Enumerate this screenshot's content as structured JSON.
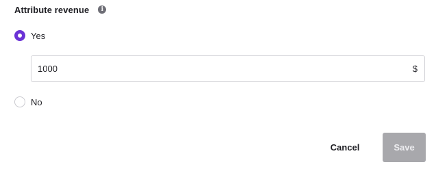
{
  "section": {
    "title": "Attribute revenue",
    "info_icon_glyph": "i",
    "info_icon": "info-icon"
  },
  "options": {
    "yes": {
      "label": "Yes",
      "selected": true
    },
    "no": {
      "label": "No",
      "selected": false
    }
  },
  "amount": {
    "value": "1000",
    "currency": "$"
  },
  "actions": {
    "cancel_label": "Cancel",
    "save_label": "Save",
    "save_disabled": true
  },
  "colors": {
    "accent": "#6b33d6",
    "disabled_button": "#a8a8ac"
  }
}
